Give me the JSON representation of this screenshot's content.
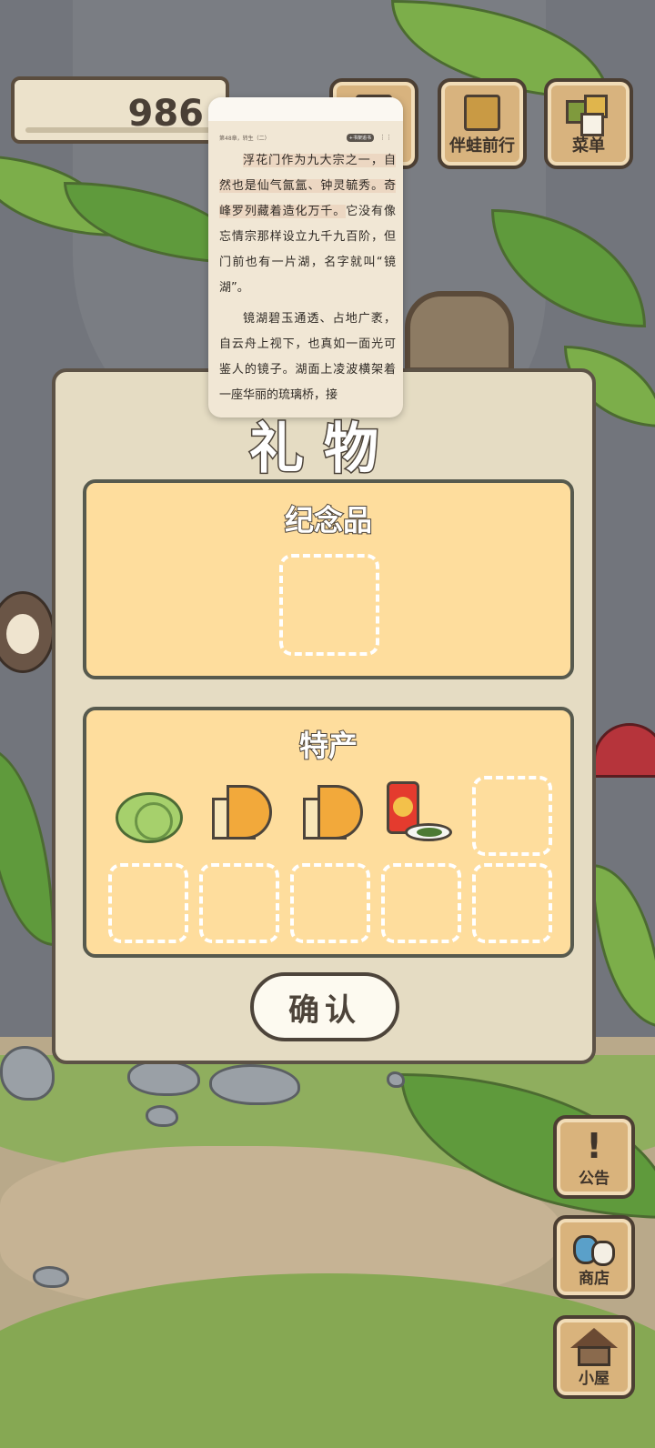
{
  "hud": {
    "clover_count": "986",
    "journey_label": "伴蛙前行",
    "menu_label": "菜单"
  },
  "side_buttons": {
    "notice_glyph": "!",
    "notice_label": "公告",
    "shop_label": "商店",
    "house_label": "小屋"
  },
  "dialog": {
    "title": "礼物",
    "souvenir": {
      "title": "纪念品",
      "slots": 1,
      "items": []
    },
    "specialty": {
      "title": "特产",
      "slots": 10,
      "items": [
        {
          "icon": "cabbage-icon"
        },
        {
          "icon": "cheese-icon"
        },
        {
          "icon": "cheese-icon"
        },
        {
          "icon": "tea-can-icon"
        }
      ]
    },
    "confirm_label": "确认"
  },
  "reader": {
    "chapter": "第48章，转生（二）",
    "follow_chip": "+书架追书",
    "more": "⋮⋮",
    "paragraph1_hl": "浮花门作为九大宗之一，自然也是仙气氤氲、钟灵毓秀。奇峰罗列藏着造化万千。",
    "paragraph1_rest": "它没有像忘情宗那样设立九千九百阶，但门前也有一片湖，名字就叫“镜湖”。",
    "paragraph2": "镜湖碧玉通透、占地广袤，自云舟上视下，也真如一面光可鉴人的镜子。湖面上凌波横架着一座华丽的琉璃桥，接"
  },
  "colors": {
    "panel_fill": "#fedd9d",
    "dialog_fill": "#e5dcc3",
    "outline": "#4d443a",
    "button_wood": "#d9b37c"
  }
}
